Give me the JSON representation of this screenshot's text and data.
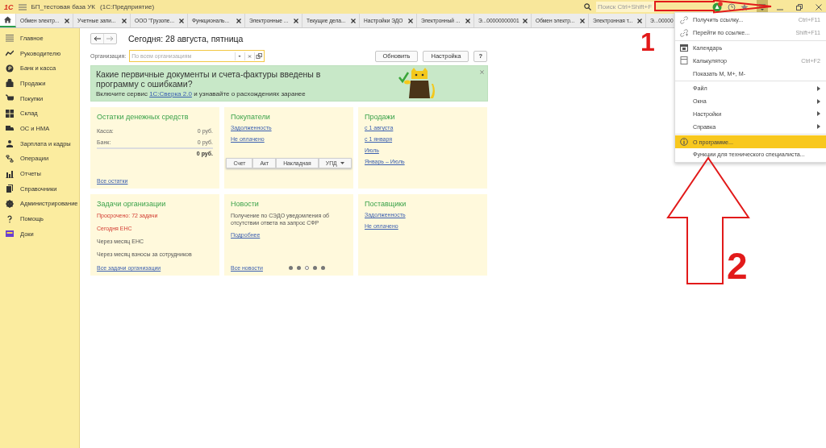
{
  "window": {
    "logo": "1С",
    "title": "БП_тестовая база УК",
    "subtitle": "(1С:Предприятие)",
    "search_placeholder": "Поиск Ctrl+Shift+F"
  },
  "tabs": [
    {
      "kind": "home",
      "selected": true
    },
    {
      "label": "Обмен электр...",
      "kind": "tab",
      "selected": false
    },
    {
      "label": "Учетные запи...",
      "kind": "tab",
      "selected": false
    },
    {
      "label": "ООО \"Грузопе...",
      "kind": "tab",
      "selected": false
    },
    {
      "label": "Функциональ...",
      "kind": "tab",
      "selected": false
    },
    {
      "label": "Электронные ...",
      "kind": "tab",
      "selected": false
    },
    {
      "label": "Текущие дела...",
      "kind": "tab",
      "selected": false
    },
    {
      "label": "Настройки ЭДО",
      "kind": "tab",
      "selected": false
    },
    {
      "label": "Электронный ...",
      "kind": "tab",
      "selected": false
    },
    {
      "label": "Э...00000000001",
      "kind": "tab",
      "selected": false
    },
    {
      "label": "Обмен электр...",
      "kind": "tab",
      "selected": false
    },
    {
      "label": "Электронная т...",
      "kind": "tab",
      "selected": false
    },
    {
      "label": "Э...00000",
      "kind": "tab",
      "selected": false
    }
  ],
  "sidebar": {
    "items": [
      {
        "label": "Главное",
        "kind": "lines"
      },
      {
        "label": "Руководителю",
        "kind": "trend"
      },
      {
        "label": "Банк и касса",
        "kind": "coin"
      },
      {
        "label": "Продажи",
        "kind": "bag"
      },
      {
        "label": "Покупки",
        "kind": "cart"
      },
      {
        "label": "Склад",
        "kind": "grid"
      },
      {
        "label": "ОС и НМА",
        "kind": "truck"
      },
      {
        "label": "Зарплата и кадры",
        "kind": "person"
      },
      {
        "label": "Операции",
        "kind": "flow"
      },
      {
        "label": "Отчеты",
        "kind": "bars"
      },
      {
        "label": "Справочники",
        "kind": "books"
      },
      {
        "label": "Администрирование",
        "kind": "gear"
      },
      {
        "label": "Помощь",
        "kind": "help"
      },
      {
        "label": "Доки",
        "kind": "folder"
      }
    ]
  },
  "page": {
    "title": "Сегодня: 28 августа, пятница",
    "organization_label": "Организация:",
    "organization_placeholder": "По всем организациям",
    "buttons": [
      "Обновить",
      "Настройка",
      "?"
    ],
    "banner": {
      "title": "Какие первичные документы и счета-фактуры введены в программу с ошибками?",
      "text_before": "Включите сервис",
      "link": "1С:Сверка 2.0",
      "text_after": "и узнавайте о расхождениях заранее"
    },
    "cards": [
      {
        "title": "Остатки денежных средств",
        "items": [
          {
            "kind": "amount",
            "label": "Касса:",
            "value": "0 руб."
          },
          {
            "kind": "amount",
            "label": "Банк:",
            "value": "0 руб."
          },
          {
            "kind": "total",
            "value": "0 руб."
          }
        ],
        "footer": "Все остатки"
      },
      {
        "title": "Покупатели",
        "items": [
          {
            "kind": "link",
            "text": "Задолженность"
          },
          {
            "kind": "link",
            "text": "Не оплачено"
          },
          {
            "kind": "buttons",
            "buttons": [
              {
                "label": "Счет",
                "dropdown": false
              },
              {
                "label": "Акт",
                "dropdown": false
              },
              {
                "label": "Накладная",
                "dropdown": false
              },
              {
                "label": "УПД",
                "dropdown": true
              }
            ]
          }
        ]
      },
      {
        "title": "Продажи",
        "items": [
          {
            "kind": "link",
            "text": "с 1 августа"
          },
          {
            "kind": "link",
            "text": "с 1 января"
          },
          {
            "kind": "link",
            "text": "Июль"
          },
          {
            "kind": "link",
            "text": "Январь – Июль"
          }
        ]
      },
      {
        "title": "Задачи организации",
        "items": [
          {
            "kind": "text",
            "text": "Просрочено: 72 задачи",
            "overdue": true
          },
          {
            "kind": "text",
            "text": "Сегодня ЕНС",
            "overdue": true
          },
          {
            "kind": "text",
            "text": "Через месяц ЕНС",
            "overdue": false
          },
          {
            "kind": "text",
            "text": "Через месяц взносы за сотрудников",
            "overdue": false
          }
        ],
        "footer": "Все задачи организации"
      },
      {
        "title": "Новости",
        "items": [
          {
            "kind": "text",
            "text": "Получение по СЭДО уведомления об отсутствии ответа на запрос СФР",
            "overdue": false
          },
          {
            "kind": "link",
            "text": "Подробнее"
          }
        ],
        "footer": "Все новости",
        "pager": [
          {
            "selected": false
          },
          {
            "selected": false
          },
          {
            "selected": true
          },
          {
            "selected": false
          },
          {
            "selected": false
          }
        ]
      },
      {
        "title": "Поставщики",
        "items": [
          {
            "kind": "link",
            "text": "Задолженность"
          },
          {
            "kind": "link",
            "text": "Не оплачено"
          }
        ]
      }
    ]
  },
  "menu": {
    "groups": [
      [
        {
          "label": "Получить ссылку...",
          "shortcut": "Ctrl+F11",
          "submenu": false,
          "selected": false
        },
        {
          "label": "Перейти по ссылке...",
          "shortcut": "Shift+F11",
          "submenu": false,
          "selected": false
        }
      ],
      [
        {
          "label": "Календарь",
          "submenu": false,
          "selected": false
        },
        {
          "label": "Калькулятор",
          "shortcut": "Ctrl+F2",
          "submenu": false,
          "selected": false
        },
        {
          "label": "Показать М, М+, М-",
          "submenu": false,
          "selected": false
        }
      ],
      [
        {
          "label": "Файл",
          "submenu": true,
          "selected": false
        },
        {
          "label": "Окна",
          "submenu": true,
          "selected": false
        },
        {
          "label": "Настройки",
          "submenu": true,
          "selected": false
        },
        {
          "label": "Справка",
          "submenu": true,
          "selected": false
        }
      ],
      [
        {
          "label": "О программе...",
          "submenu": false,
          "selected": true
        },
        {
          "label": "Функции для технического специалиста...",
          "submenu": false,
          "selected": false
        }
      ]
    ]
  },
  "annotations": [
    "1",
    "2"
  ]
}
